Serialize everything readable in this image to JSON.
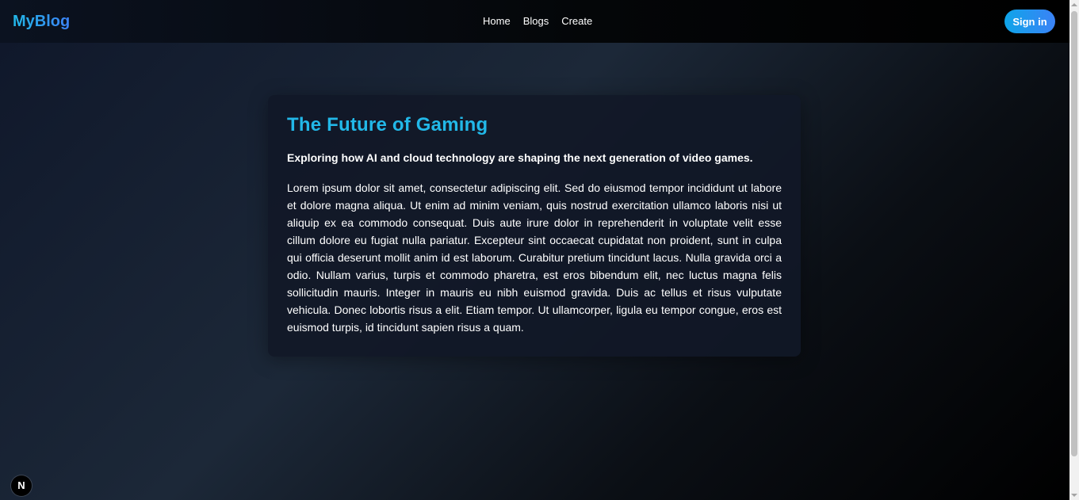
{
  "header": {
    "brand": "MyBlog",
    "nav": [
      "Home",
      "Blogs",
      "Create"
    ],
    "signin_label": "Sign in"
  },
  "post": {
    "title": "The Future of Gaming",
    "subtitle": "Exploring how AI and cloud technology are shaping the next generation of video games.",
    "body": "Lorem ipsum dolor sit amet, consectetur adipiscing elit. Sed do eiusmod tempor incididunt ut labore et dolore magna aliqua. Ut enim ad minim veniam, quis nostrud exercitation ullamco laboris nisi ut aliquip ex ea commodo consequat. Duis aute irure dolor in reprehenderit in voluptate velit esse cillum dolore eu fugiat nulla pariatur. Excepteur sint occaecat cupidatat non proident, sunt in culpa qui officia deserunt mollit anim id est laborum. Curabitur pretium tincidunt lacus. Nulla gravida orci a odio. Nullam varius, turpis et commodo pharetra, est eros bibendum elit, nec luctus magna felis sollicitudin mauris. Integer in mauris eu nibh euismod gravida. Duis ac tellus et risus vulputate vehicula. Donec lobortis risus a elit. Etiam tempor. Ut ullamcorper, ligula eu tempor congue, eros est euismod turpis, id tincidunt sapien risus a quam."
  },
  "dev_badge": {
    "icon": "nextjs-icon",
    "glyph": "N"
  },
  "colors": {
    "accent": "#22b8e8",
    "button_gradient_start": "#0ea5e9",
    "button_gradient_end": "#3b82f6",
    "card_background": "#111827"
  }
}
